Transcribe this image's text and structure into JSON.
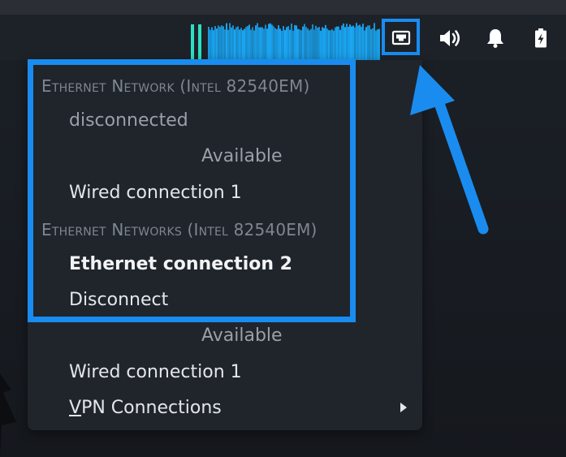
{
  "panel": {
    "tray": {
      "network_icon": "ethernet-port-icon",
      "volume_icon": "speaker-icon",
      "notifications_icon": "bell-icon",
      "battery_icon": "battery-charging-icon"
    },
    "accent_color": "#1a8cf0",
    "visualizer_colors": [
      "#2ce0c0",
      "#1aa7f5"
    ]
  },
  "network_menu": {
    "section_1_title": "Ethernet Network (Intel 82540EM)",
    "section_1_status": "disconnected",
    "section_1_available_header": "Available",
    "section_1_available_item": "Wired connection 1",
    "section_2_title": "Ethernet Networks (Intel 82540EM)",
    "section_2_active": "Ethernet connection 2",
    "section_2_disconnect": "Disconnect",
    "section_2_available_header": "Available",
    "section_2_available_item": "Wired connection 1",
    "vpn_label": "VPN Connections",
    "vpn_mnemonic": "V",
    "vpn_rest": "PN Connections",
    "submenu_icon": "triangle-right-icon"
  }
}
